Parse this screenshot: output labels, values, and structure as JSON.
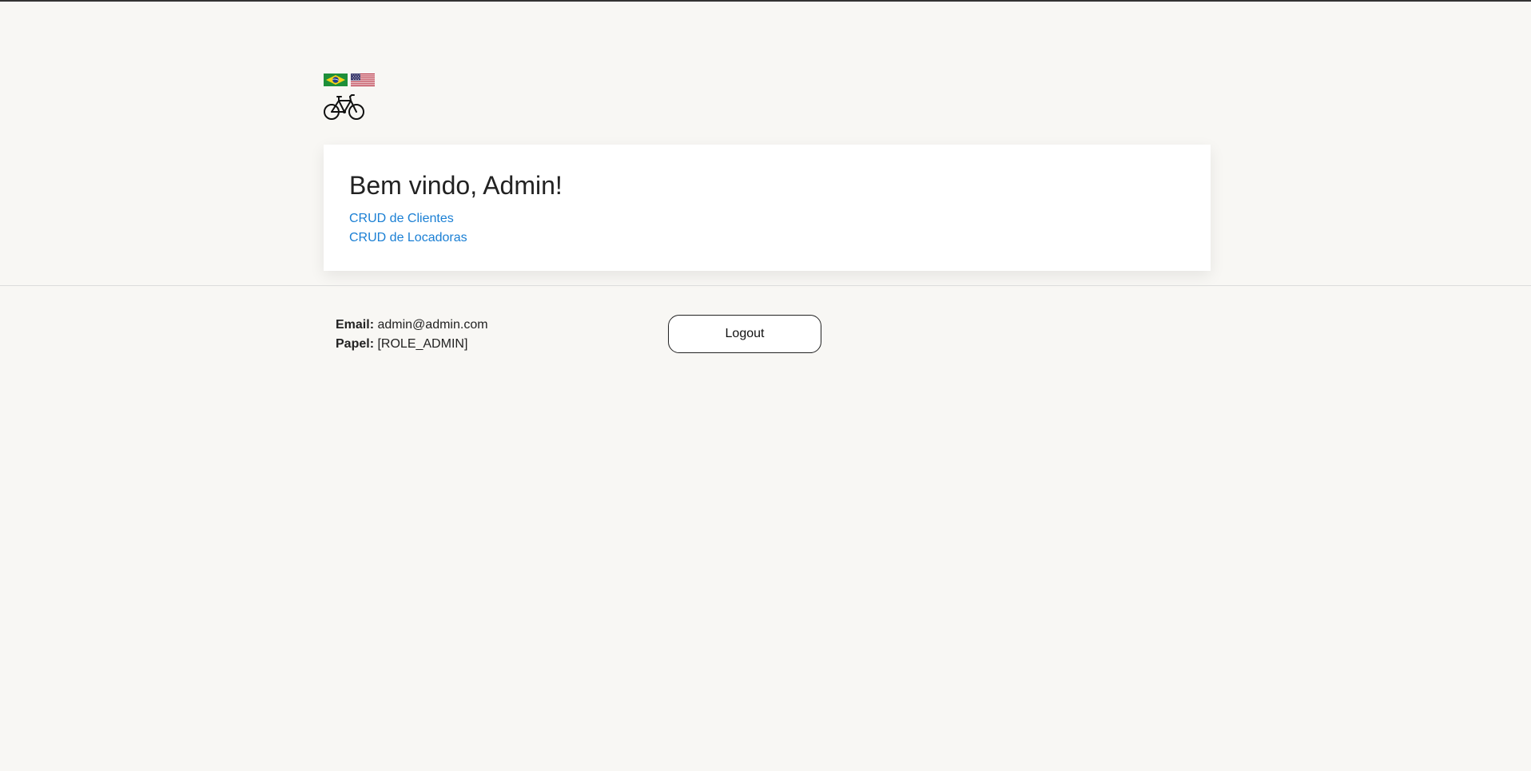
{
  "header": {
    "flags": [
      {
        "icon": "brazil-flag-icon",
        "language": "pt-BR"
      },
      {
        "icon": "usa-flag-icon",
        "language": "en-US"
      }
    ],
    "logo_icon": "bicycle-icon"
  },
  "welcome": {
    "title": "Bem vindo, Admin!",
    "links": [
      {
        "label": "CRUD de Clientes"
      },
      {
        "label": "CRUD de Locadoras"
      }
    ]
  },
  "user": {
    "email_label": "Email:",
    "email_value": "admin@admin.com",
    "role_label": "Papel:",
    "role_value": "[ROLE_ADMIN]"
  },
  "actions": {
    "logout_label": "Logout"
  },
  "colors": {
    "background": "#f8f7f4",
    "link": "#1a7fd4",
    "card": "#ffffff"
  }
}
